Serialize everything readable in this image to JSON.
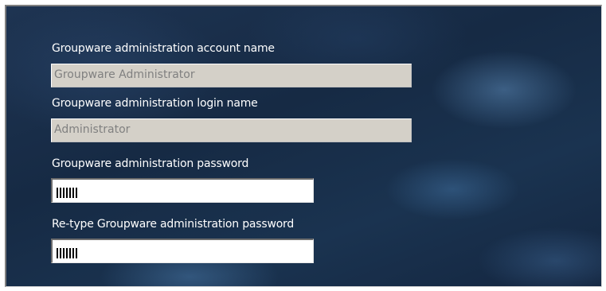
{
  "form": {
    "account_name": {
      "label": "Groupware administration account name",
      "value": "Groupware Administrator"
    },
    "login_name": {
      "label": "Groupware administration login name",
      "value": "Administrator"
    },
    "password": {
      "label": "Groupware administration password",
      "masked_length": 7
    },
    "password_confirm": {
      "label": "Re-type Groupware administration password",
      "masked_length": 7
    }
  },
  "colors": {
    "panel_background": "#1a3050",
    "label_text": "#ffffff",
    "disabled_field": "#d4d0c8",
    "disabled_text": "#808080"
  }
}
